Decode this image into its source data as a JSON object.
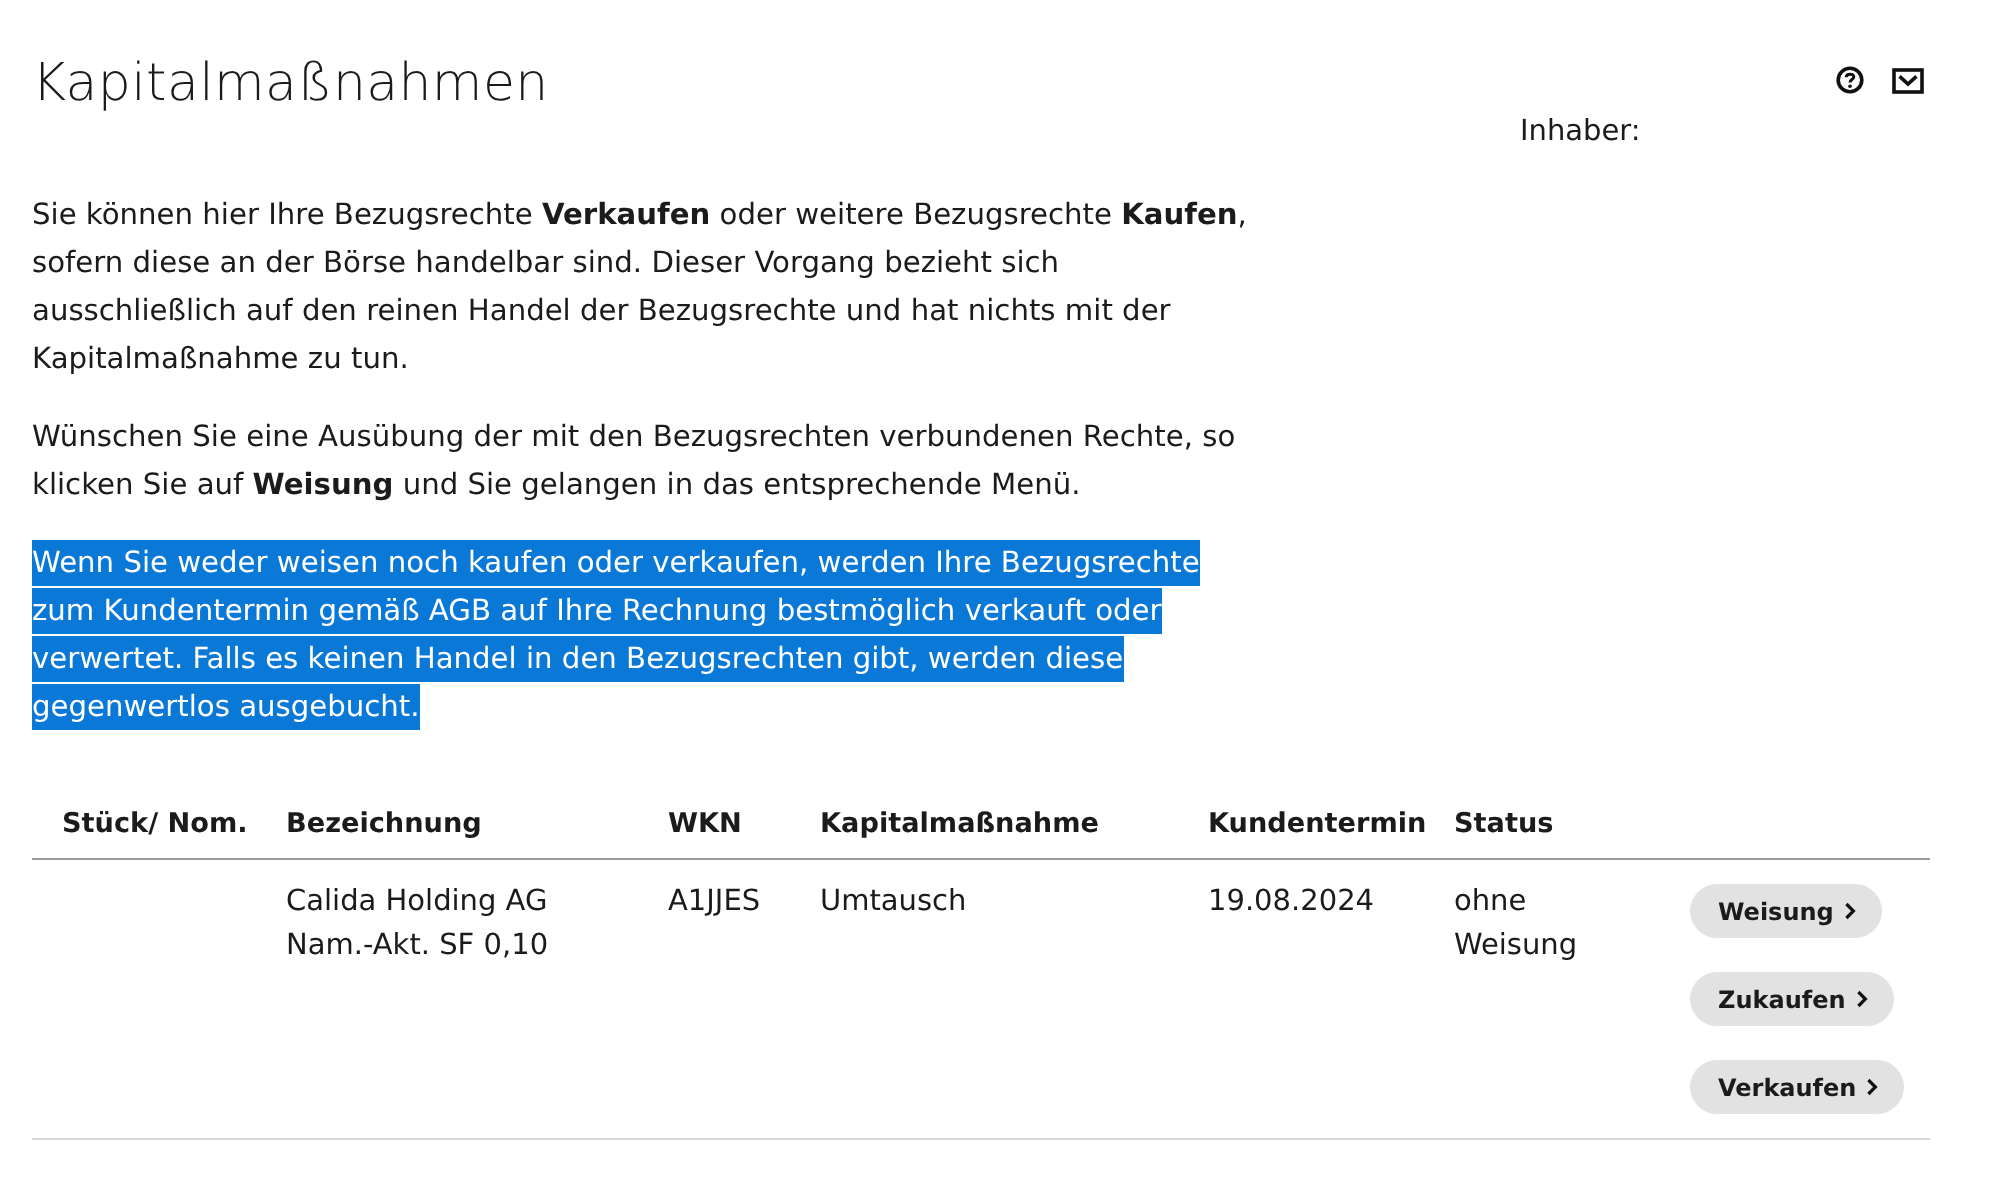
{
  "page": {
    "title": "Kapitalmaßnahmen",
    "owner_label": "Inhaber:"
  },
  "paragraphs": [
    {
      "text": "Sie können hier Ihre Bezugsrechte **Verkaufen** oder weitere Bezugsrechte **Kaufen**, sofern diese an der Börse handelbar sind. Dieser Vorgang bezieht sich ausschließlich auf den reinen Handel der Bezugsrechte und hat nichts mit der Kapitalmaßnahme zu tun.",
      "selected": false
    },
    {
      "text": "Wünschen Sie eine Ausübung der mit den Bezugsrechten verbundenen Rechte, so klicken Sie auf **Weisung** und Sie gelangen in das entsprechende Menü.",
      "selected": false
    },
    {
      "text": "Wenn Sie weder weisen noch kaufen oder verkaufen, werden Ihre Bezugsrechte zum Kundentermin gemäß AGB auf Ihre Rechnung bestmöglich verkauft oder verwertet. Falls es keinen Handel in den Bezugsrechten gibt, werden diese gegenwertlos ausgebucht.",
      "selected": true
    }
  ],
  "table": {
    "columns": [
      "Stück/ Nom.",
      "Bezeichnung",
      "WKN",
      "Kapitalmaßnahme",
      "Kundentermin",
      "Status"
    ],
    "rows": [
      {
        "name": "Calida Holding AG Nam.-Akt. SF 0,10",
        "wkn": "A1JJES",
        "corporate_action": "Umtausch",
        "customer_date": "19.08.2024",
        "status": "ohne Weisung",
        "buttons": [
          "Weisung",
          "Zukaufen",
          "Verkaufen"
        ]
      }
    ]
  }
}
